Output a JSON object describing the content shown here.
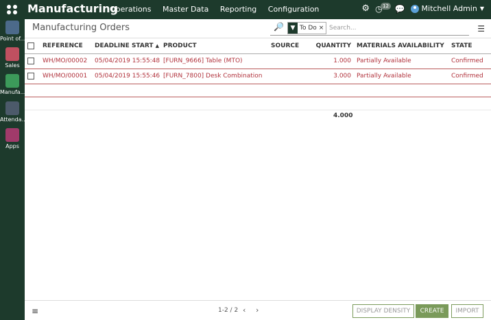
{
  "topbar": {
    "brand": "Manufacturing",
    "menu": [
      "Operations",
      "Master Data",
      "Reporting",
      "Configuration"
    ],
    "activity_count": "12",
    "user": "Mitchell Admin"
  },
  "sidebar": {
    "apps": [
      {
        "label": "Point of...",
        "icon": "point-of-sale-icon",
        "color": "#4c6a8a"
      },
      {
        "label": "Sales",
        "icon": "sales-chart-icon",
        "color": "#c05060"
      },
      {
        "label": "Manufa...",
        "icon": "factory-icon",
        "color": "#3c9a5a"
      },
      {
        "label": "Attenda...",
        "icon": "attendance-icon",
        "color": "#4c5a6a"
      },
      {
        "label": "Apps",
        "icon": "apps-icon",
        "color": "#a03a6a"
      }
    ]
  },
  "control_panel": {
    "breadcrumb": "Manufacturing Orders",
    "filter_facet": "To Do",
    "search_placeholder": "Search..."
  },
  "table": {
    "columns": [
      "REFERENCE",
      "DEADLINE START",
      "PRODUCT",
      "SOURCE",
      "QUANTITY",
      "MATERIALS AVAILABILITY",
      "STATE"
    ],
    "sort_indicator": "▲",
    "rows": [
      {
        "reference": "WH/MO/00002",
        "deadline": "05/04/2019 15:55:48",
        "product": "[FURN_9666] Table (MTO)",
        "source": "",
        "quantity": "1.000",
        "availability": "Partially Available",
        "state": "Confirmed"
      },
      {
        "reference": "WH/MO/00001",
        "deadline": "05/04/2019 15:55:46",
        "product": "[FURN_7800] Desk Combination",
        "source": "",
        "quantity": "3.000",
        "availability": "Partially Available",
        "state": "Confirmed"
      }
    ],
    "total_quantity": "4.000"
  },
  "footer": {
    "pager": "1-2 / 2",
    "display_density": "DISPLAY DENSITY",
    "create": "CREATE",
    "import": "IMPORT"
  },
  "colors": {
    "brand_bg": "#1d3a2c",
    "row_text": "#b0303a",
    "primary_button": "#7a9a5a"
  }
}
